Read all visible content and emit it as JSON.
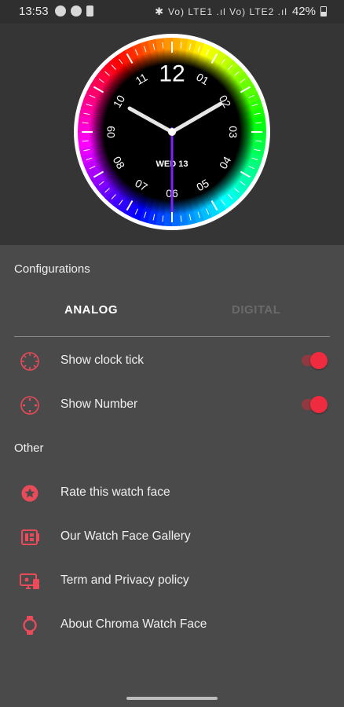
{
  "status_bar": {
    "time": "13:53",
    "right_text": "Vo) LTE1 .ıl Vo) LTE2 .ıl",
    "battery": "42%"
  },
  "watch_face": {
    "hour_numbers": [
      "12",
      "01",
      "02",
      "03",
      "04",
      "05",
      "06",
      "07",
      "08",
      "09",
      "10",
      "11"
    ],
    "date": "WED 13",
    "colors": {
      "ring": "rainbow",
      "center": "#000000",
      "second_hand": "#7a22ff",
      "hands": "#e8e8e8"
    }
  },
  "configurations": {
    "title": "Configurations",
    "tabs": [
      {
        "label": "ANALOG",
        "selected": true
      },
      {
        "label": "DIGITAL",
        "selected": false
      }
    ],
    "options": [
      {
        "label": "Show clock tick",
        "icon": "clock-tick-icon",
        "enabled": true
      },
      {
        "label": "Show Number",
        "icon": "clock-number-icon",
        "enabled": true
      }
    ]
  },
  "other": {
    "title": "Other",
    "items": [
      {
        "label": "Rate this watch face",
        "icon": "star-icon"
      },
      {
        "label": "Our Watch Face Gallery",
        "icon": "gallery-icon"
      },
      {
        "label": "Term and Privacy policy",
        "icon": "privacy-icon"
      },
      {
        "label": "About Chroma Watch Face",
        "icon": "watch-icon"
      }
    ]
  },
  "accent_color": "#ef2b3f",
  "icon_color": "#e94b5a"
}
